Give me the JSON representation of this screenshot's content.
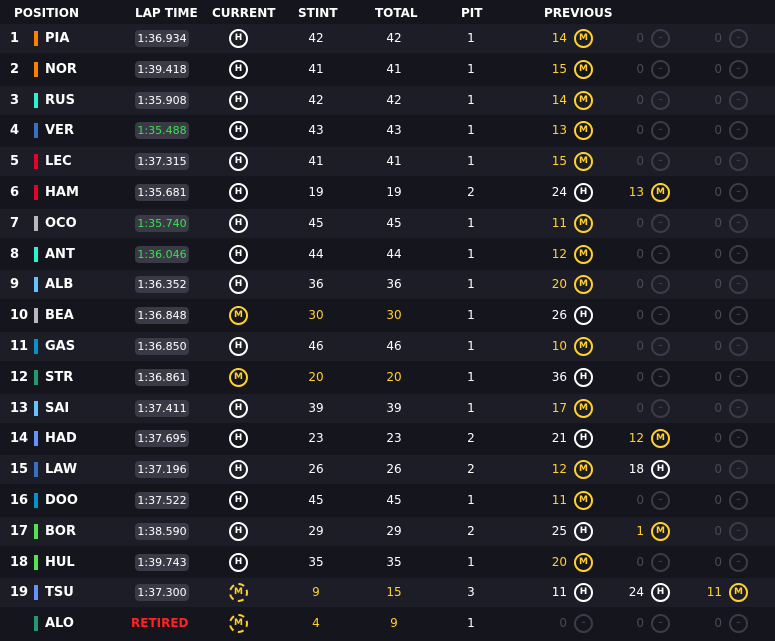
{
  "header": {
    "position": "POSITION",
    "lap_time": "LAP TIME",
    "current": "CURRENT",
    "stint": "STINT",
    "total": "TOTAL",
    "pit": "PIT",
    "previous": "PREVIOUS"
  },
  "tyre_colors": {
    "H": "#ffffff",
    "M": "#ffd12e",
    "none": "#3c3c48"
  },
  "rows": [
    {
      "pos": "1",
      "code": "PIA",
      "color": "#ff8000",
      "lap": "1:36.934",
      "lap_best": false,
      "current": "H",
      "current_new": false,
      "stint": "42",
      "total": "42",
      "pit": "1",
      "stint_hl": false,
      "prev": [
        {
          "laps": "14",
          "tyre": "M"
        },
        {
          "laps": "0",
          "tyre": "none"
        },
        {
          "laps": "0",
          "tyre": "none"
        }
      ]
    },
    {
      "pos": "2",
      "code": "NOR",
      "color": "#ff8000",
      "lap": "1:39.418",
      "lap_best": false,
      "current": "H",
      "current_new": false,
      "stint": "41",
      "total": "41",
      "pit": "1",
      "stint_hl": false,
      "prev": [
        {
          "laps": "15",
          "tyre": "M"
        },
        {
          "laps": "0",
          "tyre": "none"
        },
        {
          "laps": "0",
          "tyre": "none"
        }
      ]
    },
    {
      "pos": "3",
      "code": "RUS",
      "color": "#27f4d2",
      "lap": "1:35.908",
      "lap_best": false,
      "current": "H",
      "current_new": false,
      "stint": "42",
      "total": "42",
      "pit": "1",
      "stint_hl": false,
      "prev": [
        {
          "laps": "14",
          "tyre": "M"
        },
        {
          "laps": "0",
          "tyre": "none"
        },
        {
          "laps": "0",
          "tyre": "none"
        }
      ]
    },
    {
      "pos": "4",
      "code": "VER",
      "color": "#3671c6",
      "lap": "1:35.488",
      "lap_best": true,
      "current": "H",
      "current_new": false,
      "stint": "43",
      "total": "43",
      "pit": "1",
      "stint_hl": false,
      "prev": [
        {
          "laps": "13",
          "tyre": "M"
        },
        {
          "laps": "0",
          "tyre": "none"
        },
        {
          "laps": "0",
          "tyre": "none"
        }
      ]
    },
    {
      "pos": "5",
      "code": "LEC",
      "color": "#e8002d",
      "lap": "1:37.315",
      "lap_best": false,
      "current": "H",
      "current_new": false,
      "stint": "41",
      "total": "41",
      "pit": "1",
      "stint_hl": false,
      "prev": [
        {
          "laps": "15",
          "tyre": "M"
        },
        {
          "laps": "0",
          "tyre": "none"
        },
        {
          "laps": "0",
          "tyre": "none"
        }
      ]
    },
    {
      "pos": "6",
      "code": "HAM",
      "color": "#e8002d",
      "lap": "1:35.681",
      "lap_best": false,
      "current": "H",
      "current_new": false,
      "stint": "19",
      "total": "19",
      "pit": "2",
      "stint_hl": false,
      "prev": [
        {
          "laps": "24",
          "tyre": "H"
        },
        {
          "laps": "13",
          "tyre": "M"
        },
        {
          "laps": "0",
          "tyre": "none"
        }
      ]
    },
    {
      "pos": "7",
      "code": "OCO",
      "color": "#b6babd",
      "lap": "1:35.740",
      "lap_best": true,
      "current": "H",
      "current_new": false,
      "stint": "45",
      "total": "45",
      "pit": "1",
      "stint_hl": false,
      "prev": [
        {
          "laps": "11",
          "tyre": "M"
        },
        {
          "laps": "0",
          "tyre": "none"
        },
        {
          "laps": "0",
          "tyre": "none"
        }
      ]
    },
    {
      "pos": "8",
      "code": "ANT",
      "color": "#27f4d2",
      "lap": "1:36.046",
      "lap_best": true,
      "current": "H",
      "current_new": false,
      "stint": "44",
      "total": "44",
      "pit": "1",
      "stint_hl": false,
      "prev": [
        {
          "laps": "12",
          "tyre": "M"
        },
        {
          "laps": "0",
          "tyre": "none"
        },
        {
          "laps": "0",
          "tyre": "none"
        }
      ]
    },
    {
      "pos": "9",
      "code": "ALB",
      "color": "#64c4ff",
      "lap": "1:36.352",
      "lap_best": false,
      "current": "H",
      "current_new": false,
      "stint": "36",
      "total": "36",
      "pit": "1",
      "stint_hl": false,
      "prev": [
        {
          "laps": "20",
          "tyre": "M"
        },
        {
          "laps": "0",
          "tyre": "none"
        },
        {
          "laps": "0",
          "tyre": "none"
        }
      ]
    },
    {
      "pos": "10",
      "code": "BEA",
      "color": "#b6babd",
      "lap": "1:36.848",
      "lap_best": false,
      "current": "M",
      "current_new": false,
      "stint": "30",
      "total": "30",
      "pit": "1",
      "stint_hl": true,
      "prev": [
        {
          "laps": "26",
          "tyre": "H"
        },
        {
          "laps": "0",
          "tyre": "none"
        },
        {
          "laps": "0",
          "tyre": "none"
        }
      ]
    },
    {
      "pos": "11",
      "code": "GAS",
      "color": "#0093cc",
      "lap": "1:36.850",
      "lap_best": false,
      "current": "H",
      "current_new": false,
      "stint": "46",
      "total": "46",
      "pit": "1",
      "stint_hl": false,
      "prev": [
        {
          "laps": "10",
          "tyre": "M"
        },
        {
          "laps": "0",
          "tyre": "none"
        },
        {
          "laps": "0",
          "tyre": "none"
        }
      ]
    },
    {
      "pos": "12",
      "code": "STR",
      "color": "#229971",
      "lap": "1:36.861",
      "lap_best": false,
      "current": "M",
      "current_new": false,
      "stint": "20",
      "total": "20",
      "pit": "1",
      "stint_hl": true,
      "prev": [
        {
          "laps": "36",
          "tyre": "H"
        },
        {
          "laps": "0",
          "tyre": "none"
        },
        {
          "laps": "0",
          "tyre": "none"
        }
      ]
    },
    {
      "pos": "13",
      "code": "SAI",
      "color": "#64c4ff",
      "lap": "1:37.411",
      "lap_best": false,
      "current": "H",
      "current_new": false,
      "stint": "39",
      "total": "39",
      "pit": "1",
      "stint_hl": false,
      "prev": [
        {
          "laps": "17",
          "tyre": "M"
        },
        {
          "laps": "0",
          "tyre": "none"
        },
        {
          "laps": "0",
          "tyre": "none"
        }
      ]
    },
    {
      "pos": "14",
      "code": "HAD",
      "color": "#6692ff",
      "lap": "1:37.695",
      "lap_best": false,
      "current": "H",
      "current_new": false,
      "stint": "23",
      "total": "23",
      "pit": "2",
      "stint_hl": false,
      "prev": [
        {
          "laps": "21",
          "tyre": "H"
        },
        {
          "laps": "12",
          "tyre": "M"
        },
        {
          "laps": "0",
          "tyre": "none"
        }
      ]
    },
    {
      "pos": "15",
      "code": "LAW",
      "color": "#3671c6",
      "lap": "1:37.196",
      "lap_best": false,
      "current": "H",
      "current_new": false,
      "stint": "26",
      "total": "26",
      "pit": "2",
      "stint_hl": false,
      "prev": [
        {
          "laps": "12",
          "tyre": "M"
        },
        {
          "laps": "18",
          "tyre": "H"
        },
        {
          "laps": "0",
          "tyre": "none"
        }
      ]
    },
    {
      "pos": "16",
      "code": "DOO",
      "color": "#0093cc",
      "lap": "1:37.522",
      "lap_best": false,
      "current": "H",
      "current_new": false,
      "stint": "45",
      "total": "45",
      "pit": "1",
      "stint_hl": false,
      "prev": [
        {
          "laps": "11",
          "tyre": "M"
        },
        {
          "laps": "0",
          "tyre": "none"
        },
        {
          "laps": "0",
          "tyre": "none"
        }
      ]
    },
    {
      "pos": "17",
      "code": "BOR",
      "color": "#52e252",
      "lap": "1:38.590",
      "lap_best": false,
      "current": "H",
      "current_new": false,
      "stint": "29",
      "total": "29",
      "pit": "2",
      "stint_hl": false,
      "prev": [
        {
          "laps": "25",
          "tyre": "H"
        },
        {
          "laps": "1",
          "tyre": "M"
        },
        {
          "laps": "0",
          "tyre": "none"
        }
      ]
    },
    {
      "pos": "18",
      "code": "HUL",
      "color": "#52e252",
      "lap": "1:39.743",
      "lap_best": false,
      "current": "H",
      "current_new": false,
      "stint": "35",
      "total": "35",
      "pit": "1",
      "stint_hl": false,
      "prev": [
        {
          "laps": "20",
          "tyre": "M"
        },
        {
          "laps": "0",
          "tyre": "none"
        },
        {
          "laps": "0",
          "tyre": "none"
        }
      ]
    },
    {
      "pos": "19",
      "code": "TSU",
      "color": "#6692ff",
      "lap": "1:37.300",
      "lap_best": false,
      "current": "M",
      "current_new": true,
      "stint": "9",
      "total": "15",
      "pit": "3",
      "stint_hl": true,
      "prev": [
        {
          "laps": "11",
          "tyre": "H"
        },
        {
          "laps": "24",
          "tyre": "H"
        },
        {
          "laps": "11",
          "tyre": "M"
        }
      ]
    },
    {
      "pos": "",
      "code": "ALO",
      "color": "#229971",
      "lap": "RETIRED",
      "lap_best": false,
      "retired": true,
      "current": "M",
      "current_new": true,
      "stint": "4",
      "total": "9",
      "pit": "1",
      "stint_hl": true,
      "prev": [
        {
          "laps": "0",
          "tyre": "none"
        },
        {
          "laps": "0",
          "tyre": "none"
        },
        {
          "laps": "0",
          "tyre": "none"
        }
      ]
    }
  ]
}
